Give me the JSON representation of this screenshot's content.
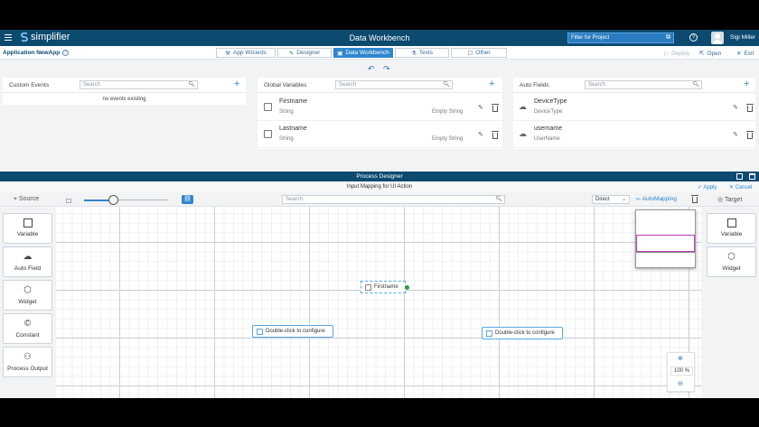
{
  "header": {
    "brand": "simplifier",
    "title": "Data Workbench",
    "filter_placeholder": "Filter for Project",
    "user_name": "Sigi Miller"
  },
  "subbar": {
    "app_name": "Application NewApp",
    "tabs": [
      {
        "label": "App Wizards",
        "icon": "wand-icon",
        "active": false
      },
      {
        "label": "Designer",
        "icon": "pencil-icon",
        "active": false
      },
      {
        "label": "Data Workbench",
        "icon": "monitor-icon",
        "active": true
      },
      {
        "label": "Tests",
        "icon": "flask-icon",
        "active": false
      },
      {
        "label": "Other",
        "icon": "square-icon",
        "active": false
      }
    ],
    "deploy_label": "Deploy",
    "open_label": "Open",
    "exit_label": "Exit"
  },
  "custom_events": {
    "title": "Custom Events",
    "search_placeholder": "Search",
    "empty_text": "no events existing"
  },
  "global_variables": {
    "title": "Global Variables",
    "search_placeholder": "Search",
    "items": [
      {
        "name": "Firstname",
        "type": "String",
        "value": "Empty String"
      },
      {
        "name": "Lastname",
        "type": "String",
        "value": "Empty String"
      }
    ]
  },
  "auto_fields": {
    "title": "Auto Fields",
    "search_placeholder": "Search",
    "items": [
      {
        "name": "DeviceType",
        "type": "DeviceType"
      },
      {
        "name": "username",
        "type": "UserName"
      }
    ]
  },
  "process_designer": {
    "title": "Process Designer",
    "subtitle": "Input Mapping for UI Action",
    "apply_label": "Apply",
    "cancel_label": "Cancel",
    "source_label": "Source",
    "target_label": "Target",
    "search_placeholder": "Search",
    "mapping_mode": "Direct",
    "automapping_label": "AutoMapping",
    "slider_value": 0.35,
    "source_palette": [
      "Variable",
      "Auto Field",
      "Widget",
      "Constant",
      "Process Output"
    ],
    "target_palette": [
      "Variable",
      "Widget"
    ],
    "nodes": {
      "firstname": "Firstname",
      "configure_left": "Double-click to configure",
      "configure_right": "Double-click to configure"
    },
    "zoom_value": "100",
    "zoom_unit": "%"
  }
}
